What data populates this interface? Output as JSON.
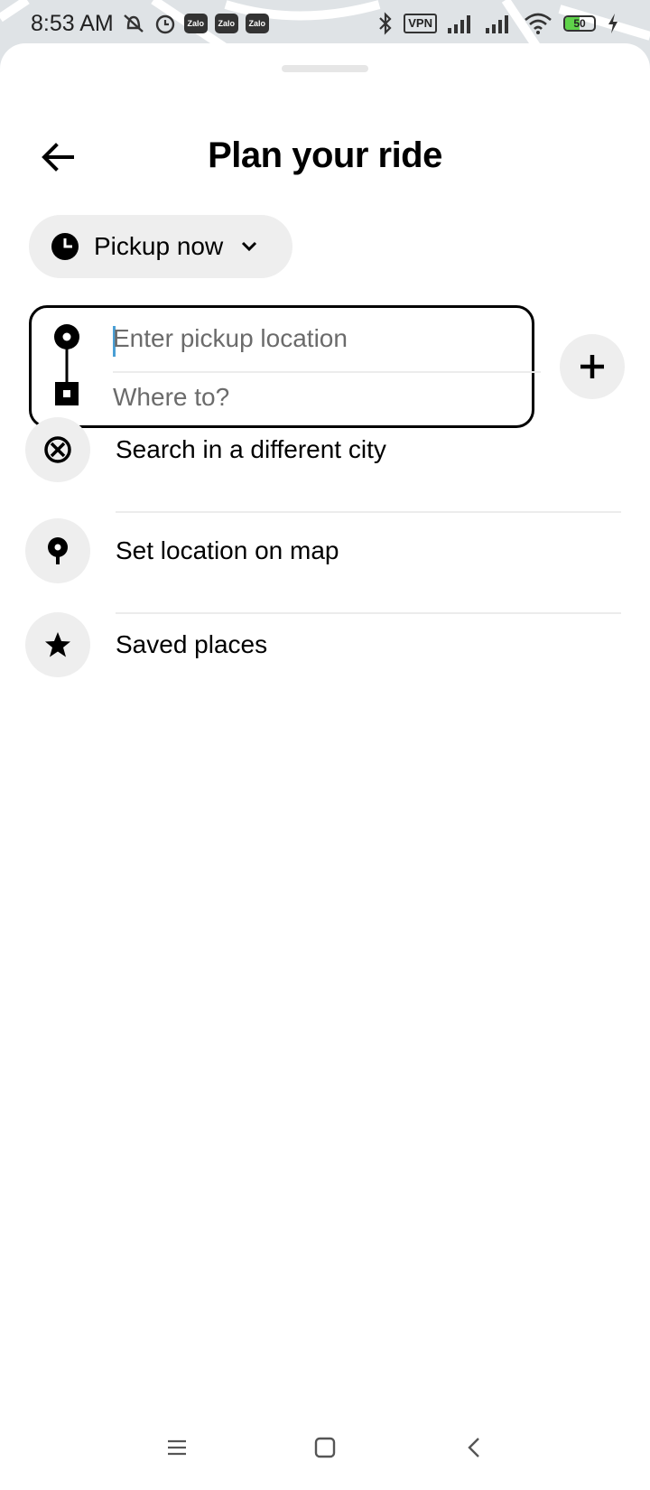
{
  "status_bar": {
    "time": "8:53 AM",
    "zalo_badges": [
      "Zalo",
      "Zalo",
      "Zalo"
    ],
    "vpn_label": "VPN",
    "battery_level": "50"
  },
  "header": {
    "title": "Plan your ride"
  },
  "pickup_time": {
    "label": "Pickup now"
  },
  "route": {
    "pickup_placeholder": "Enter pickup location",
    "destination_placeholder": "Where to?"
  },
  "options": [
    {
      "label": "Search in a different city",
      "icon": "globe-icon"
    },
    {
      "label": "Set location on map",
      "icon": "map-pin-icon"
    },
    {
      "label": "Saved places",
      "icon": "star-icon"
    }
  ],
  "colors": {
    "accent_caret": "#4a9fd5",
    "chip_background": "#eeeeee"
  }
}
